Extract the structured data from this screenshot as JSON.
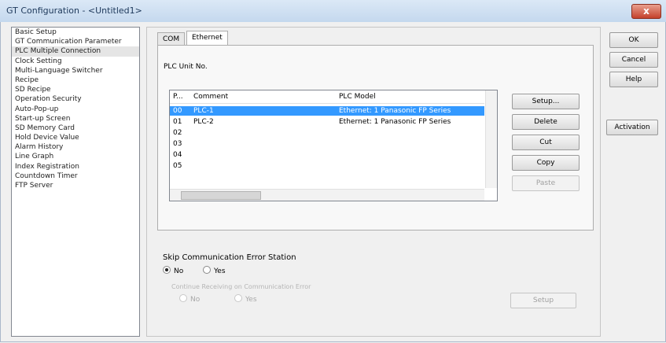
{
  "window": {
    "title": "GT Configuration - <Untitled1>",
    "close": "x"
  },
  "sidebar": {
    "items": [
      "Basic Setup",
      "GT Communication Parameter",
      "PLC Multiple Connection",
      "Clock Setting",
      "Multi-Language Switcher",
      "Recipe",
      "SD Recipe",
      "Operation Security",
      "Auto-Pop-up",
      "Start-up Screen",
      "SD Memory Card",
      "Hold Device Value",
      "Alarm History",
      "Line Graph",
      "Index Registration",
      "Countdown Timer",
      "FTP Server"
    ],
    "selected_index": 2
  },
  "tabs": [
    "COM",
    "Ethernet"
  ],
  "active_tab": 1,
  "plc_unit_label": "PLC Unit No.",
  "list": {
    "headers": [
      "P...",
      "Comment",
      "PLC Model"
    ],
    "rows": [
      {
        "no": "00",
        "comment": "PLC-1",
        "model": "Ethernet: 1 Panasonic FP Series"
      },
      {
        "no": "01",
        "comment": "PLC-2",
        "model": "Ethernet: 1 Panasonic FP Series"
      },
      {
        "no": "02",
        "comment": "",
        "model": ""
      },
      {
        "no": "03",
        "comment": "",
        "model": ""
      },
      {
        "no": "04",
        "comment": "",
        "model": ""
      },
      {
        "no": "05",
        "comment": "",
        "model": ""
      }
    ],
    "selected_row": 0
  },
  "buttons": {
    "ok": "OK",
    "cancel": "Cancel",
    "help": "Help",
    "activation": "Activation",
    "setup": "Setup...",
    "delete": "Delete",
    "cut": "Cut",
    "copy": "Copy",
    "paste": "Paste",
    "setup2": "Setup"
  },
  "skip_section": {
    "title": "Skip Communication Error Station",
    "no": "No",
    "yes": "Yes",
    "sub_label": "Continue Receiving on Communication Error",
    "sub_no": "No",
    "sub_yes": "Yes"
  }
}
